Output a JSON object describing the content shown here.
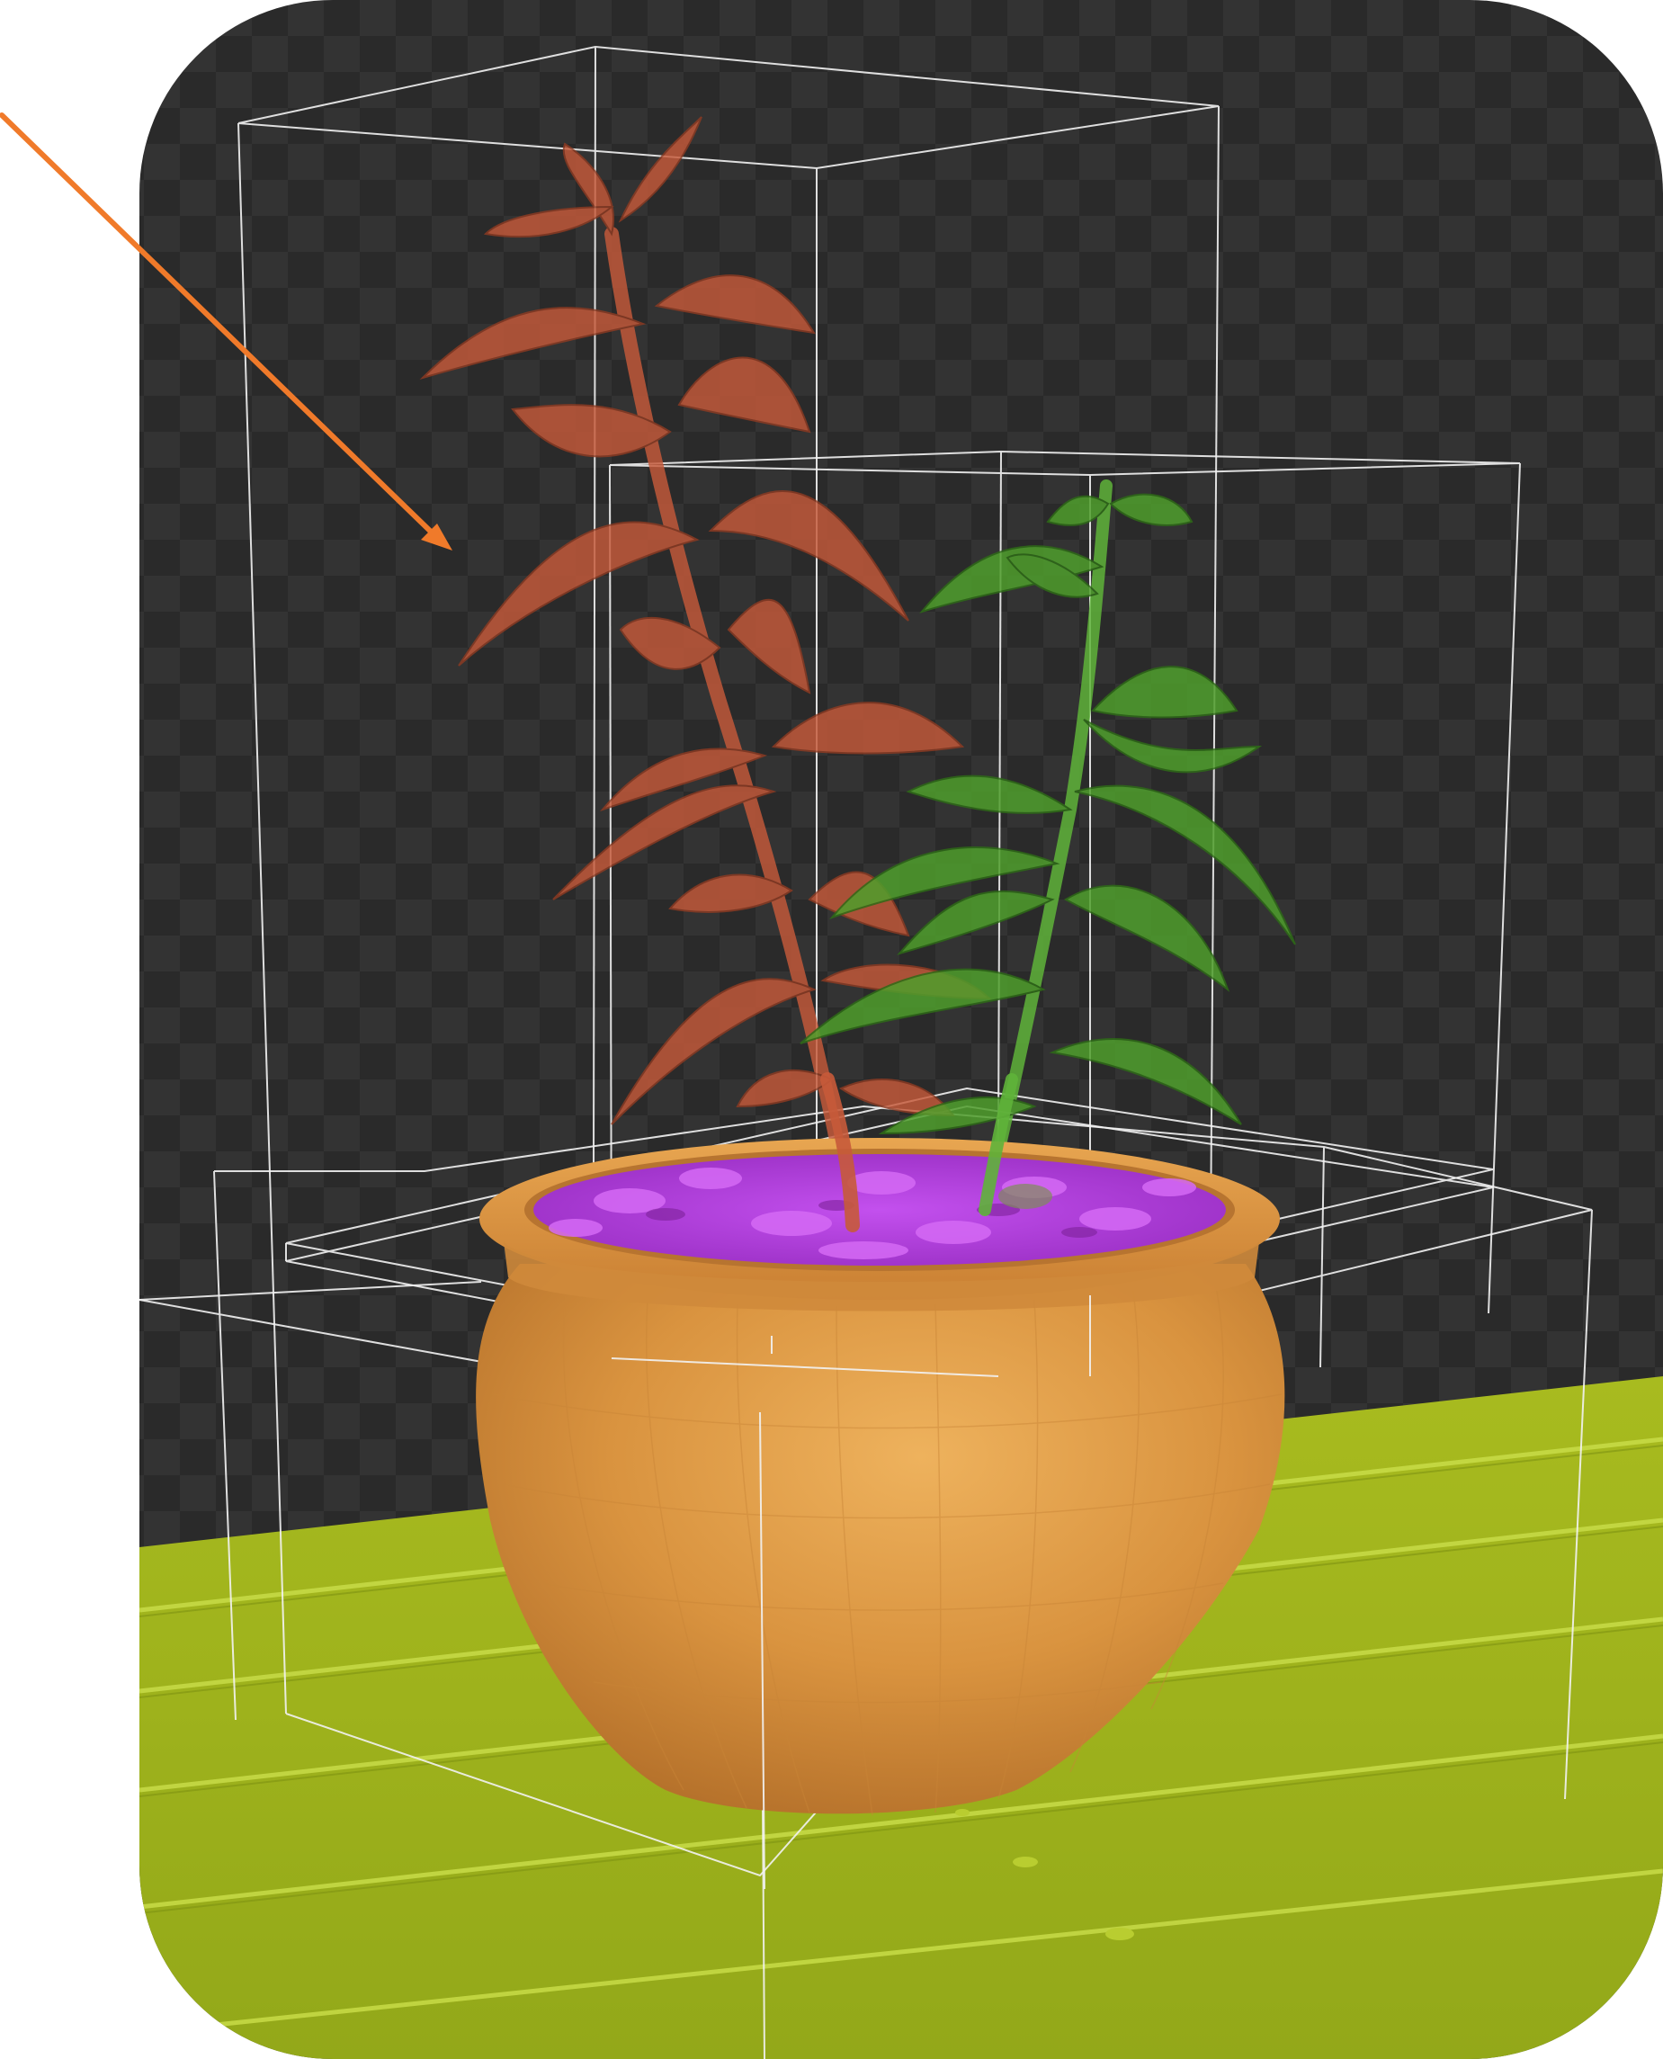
{
  "viewport": {
    "kind": "3d-viewport-render",
    "background": "transparent-checkerboard",
    "floor": "wood-planks"
  },
  "colors": {
    "checker_dark": "#2a2a2a",
    "checker_light": "#333333",
    "floor": "#9fb21c",
    "floor_light": "#b8cc2a",
    "floor_seam": "#c9dd4a",
    "pot": "#d9933f",
    "pot_light": "#eaaa56",
    "pot_dark": "#b8732a",
    "soil": "#b53ce0",
    "soil_light": "#d56af5",
    "plant_selected": "#c65a3a",
    "plant_other": "#4f9e2c",
    "bbox_lines": "#f2f2f2",
    "arrow": "#f07a2a"
  },
  "objects": [
    {
      "name": "pot",
      "selected": false
    },
    {
      "name": "soil",
      "selected": false
    },
    {
      "name": "plant-orange",
      "selected": true
    },
    {
      "name": "plant-green",
      "selected": false
    },
    {
      "name": "floor",
      "selected": false
    }
  ],
  "annotation": {
    "type": "arrow",
    "points_to": "plant-orange"
  }
}
